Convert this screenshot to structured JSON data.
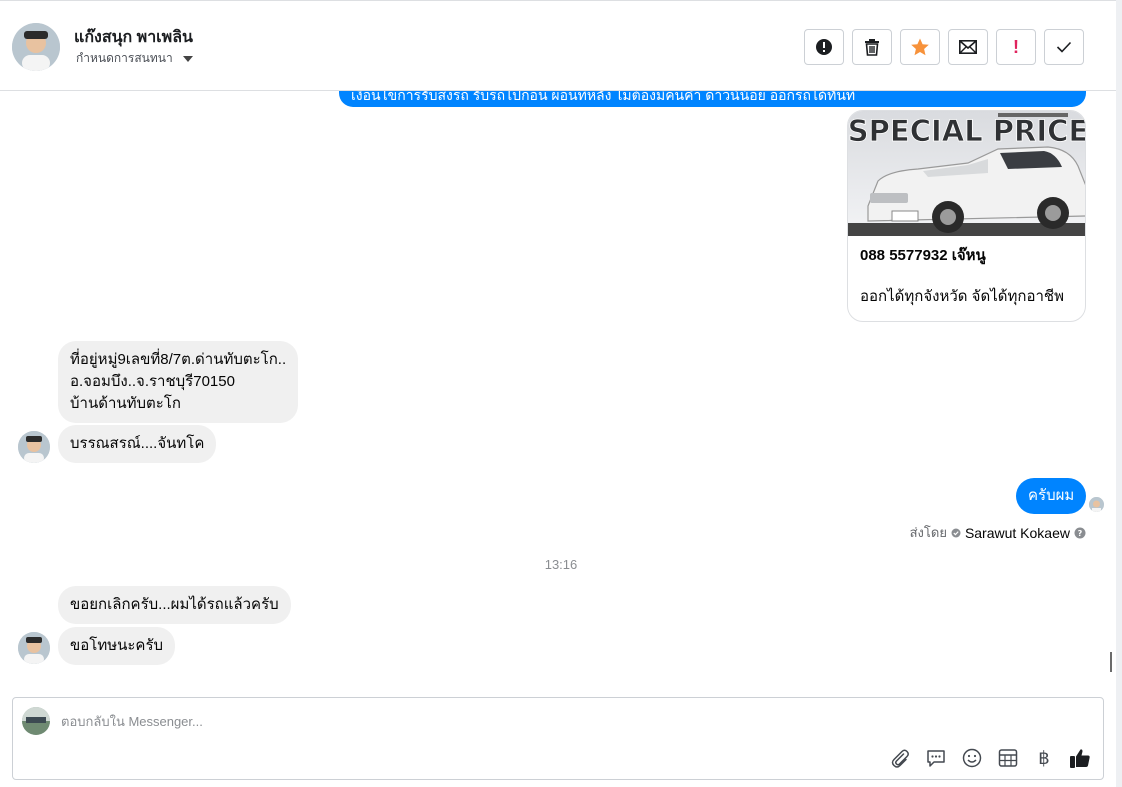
{
  "header": {
    "contact_name": "แก๊งสนุก พาเพลิน",
    "subtitle": "กำหนดการสนทนา",
    "actions": [
      {
        "name": "report-button",
        "icon": "alert-circle-icon"
      },
      {
        "name": "delete-button",
        "icon": "trash-icon"
      },
      {
        "name": "star-button",
        "icon": "star-icon"
      },
      {
        "name": "mark-unread-button",
        "icon": "envelope-icon"
      },
      {
        "name": "spam-button",
        "icon": "exclamation-icon"
      },
      {
        "name": "mark-done-button",
        "icon": "check-icon"
      }
    ]
  },
  "colors": {
    "accent": "#0084ff",
    "star": "#f7923b",
    "incoming_bubble": "#f0f0f0",
    "spam_red": "#e0245e"
  },
  "messages": {
    "top_cut_text": "เงื่อนไขการรับส่งรถ รับรถไปก่อน ผ่อนทีหลัง ไม่ต้องมีคนค้ำ ดาวน์น้อย ออกรถได้ทันที",
    "card": {
      "image_text": "SPECIAL PRICE",
      "line1": "088 5577932 เจ๊หนู",
      "line2": "ออกได้ทุกจังหวัด จัดได้ทุกอาชีพ"
    },
    "incoming_1": {
      "lines": [
        "ที่อยู่หมู่9เลขที่8/7ต.ด่านทับตะโก..",
        "อ.จอมบึง..จ.ราชบุรี70150",
        "บ้านด้านทับตะโก"
      ]
    },
    "incoming_2": "บรรณสรณ์....จันทโค",
    "outgoing_1": "ครับผม",
    "sent_by_label": "ส่งโดย",
    "sent_by_name": "Sarawut Kokaew",
    "time_separator": "13:16",
    "incoming_3": "ขอยกเลิกครับ...ผมได้รถแล้วครับ",
    "incoming_4": "ขอโทษนะครับ"
  },
  "composer": {
    "placeholder": "ตอบกลับใน Messenger...",
    "tools": [
      "paperclip-icon",
      "chat-bubble-icon",
      "smiley-icon",
      "table-icon",
      "baht-icon",
      "thumbs-up-icon"
    ],
    "baht_symbol": "฿"
  }
}
